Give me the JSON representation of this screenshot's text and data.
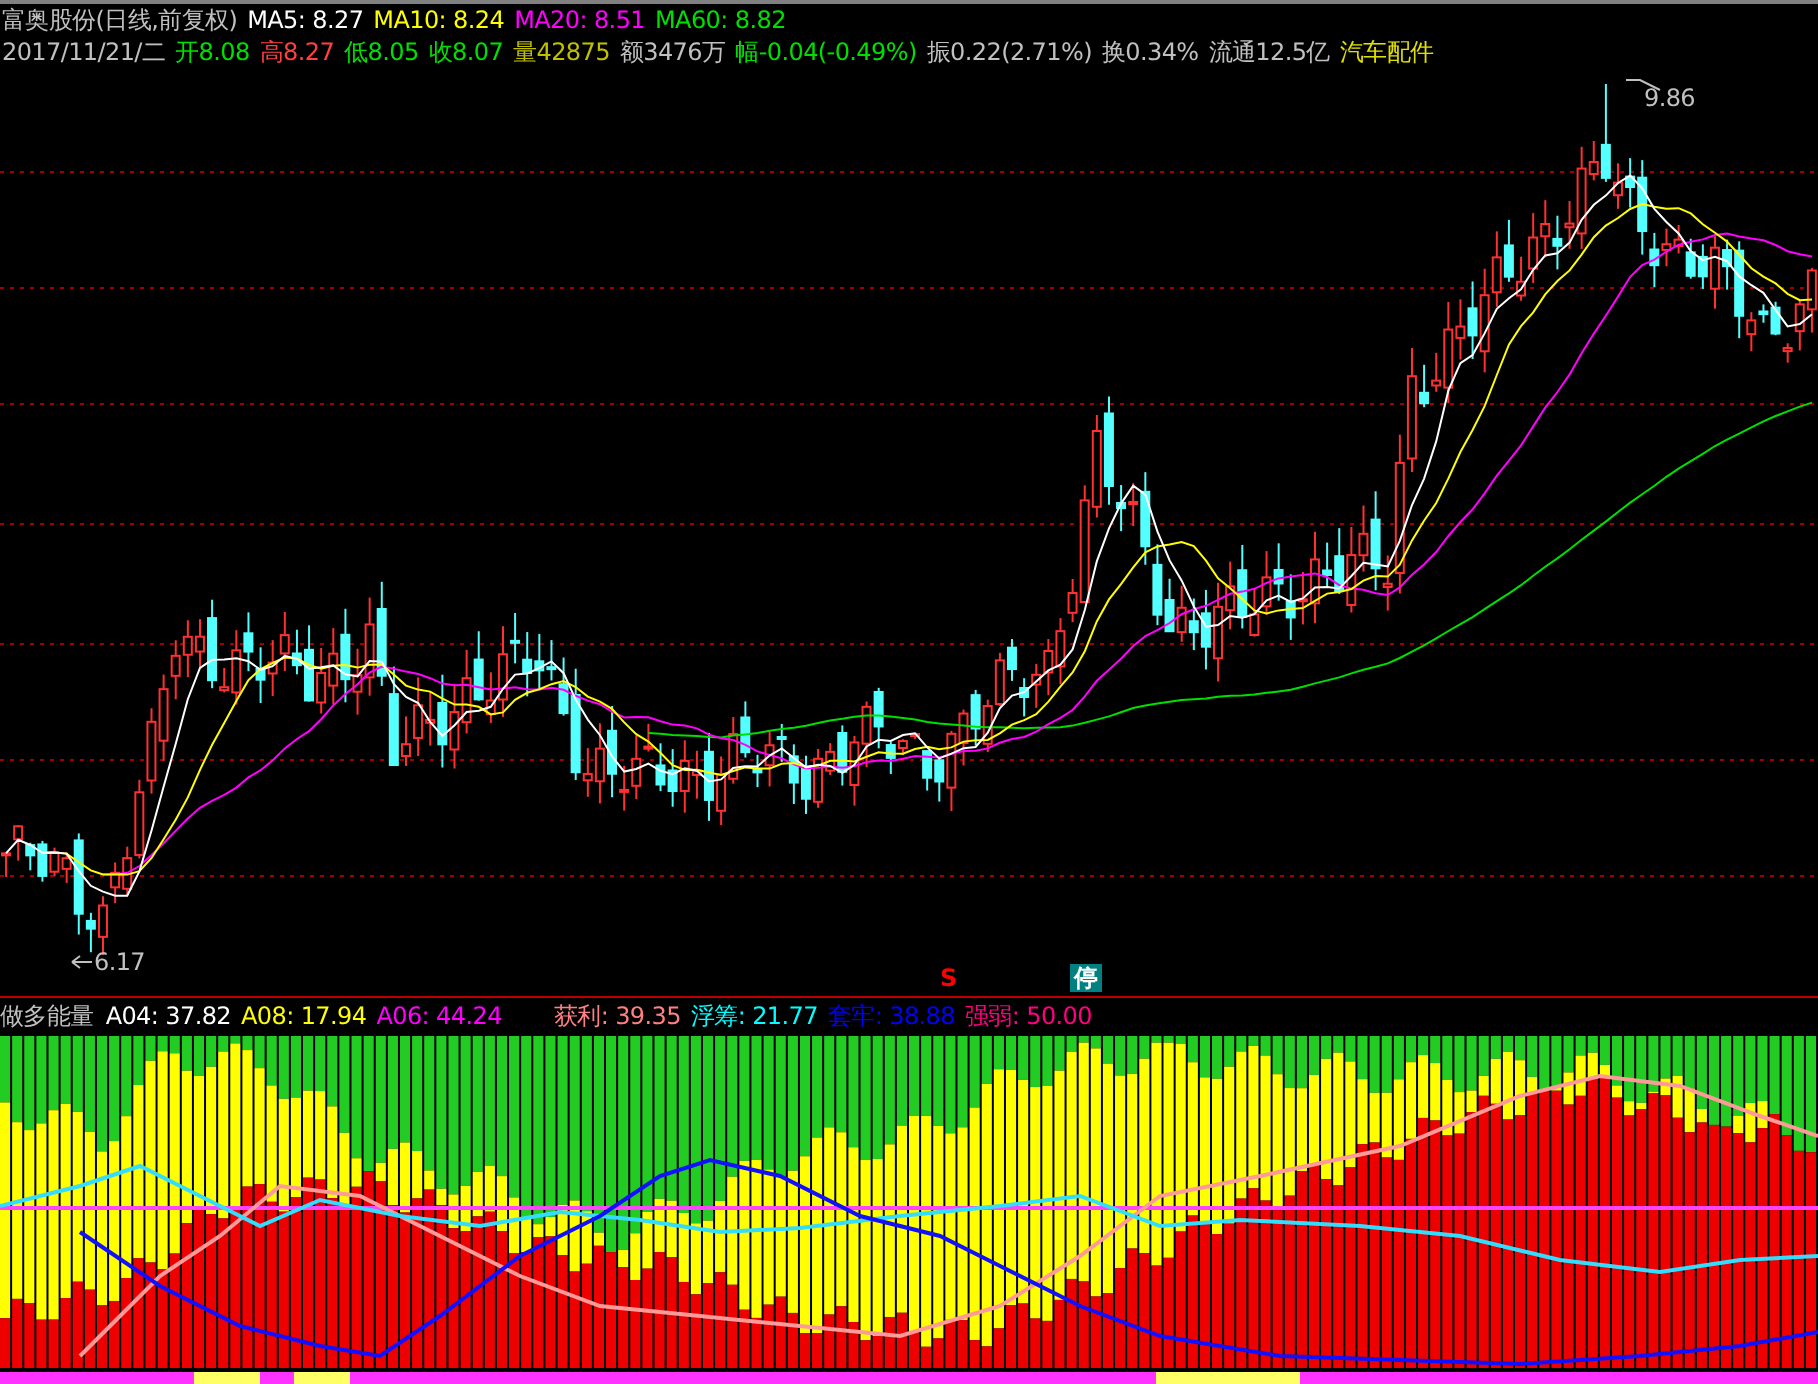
{
  "title": {
    "stock": "富奥股份(日线,前复权)",
    "ma": [
      {
        "label": "MA5: 8.27",
        "color": "#ffffff"
      },
      {
        "label": "MA10: 8.24",
        "color": "#ffff00"
      },
      {
        "label": "MA20: 8.51",
        "color": "#ff00ff"
      },
      {
        "label": "MA60: 8.82",
        "color": "#00e000"
      }
    ]
  },
  "quote": [
    {
      "label": "2017/11/21/二",
      "color": "#c0c0c0"
    },
    {
      "label": "开8.08",
      "color": "#00e000"
    },
    {
      "label": "高8.27",
      "color": "#ff4040"
    },
    {
      "label": "低8.05",
      "color": "#00e000"
    },
    {
      "label": "收8.07",
      "color": "#00e000"
    },
    {
      "label": "量42875",
      "color": "#c0c000"
    },
    {
      "label": "额3476万",
      "color": "#c0c0c0"
    },
    {
      "label": "幅-0.04(-0.49%)",
      "color": "#00e000"
    },
    {
      "label": "振0.22(2.71%)",
      "color": "#c0c0c0"
    },
    {
      "label": "换0.34%",
      "color": "#c0c0c0"
    },
    {
      "label": "流通12.5亿",
      "color": "#c0c0c0"
    },
    {
      "label": "汽车配件",
      "color": "#e0e000"
    }
  ],
  "chart": {
    "high_label": "9.86",
    "low_label": "6.17",
    "markers": [
      {
        "kind": "sell",
        "text": "S"
      },
      {
        "kind": "halt",
        "text": "停"
      }
    ]
  },
  "indicator": {
    "name": "做多能量",
    "values": [
      {
        "label": "A04: 37.82",
        "color": "#ffffff"
      },
      {
        "label": "A08: 17.94",
        "color": "#ffff00"
      },
      {
        "label": "A06: 44.24",
        "color": "#ff00ff"
      },
      {
        "label": "获利: 39.35",
        "color": "#ff8080"
      },
      {
        "label": "浮筹: 21.77",
        "color": "#00ffff"
      },
      {
        "label": "套牢: 38.88",
        "color": "#0000ff"
      },
      {
        "label": "强弱: 50.00",
        "color": "#ff0080"
      }
    ]
  }
}
